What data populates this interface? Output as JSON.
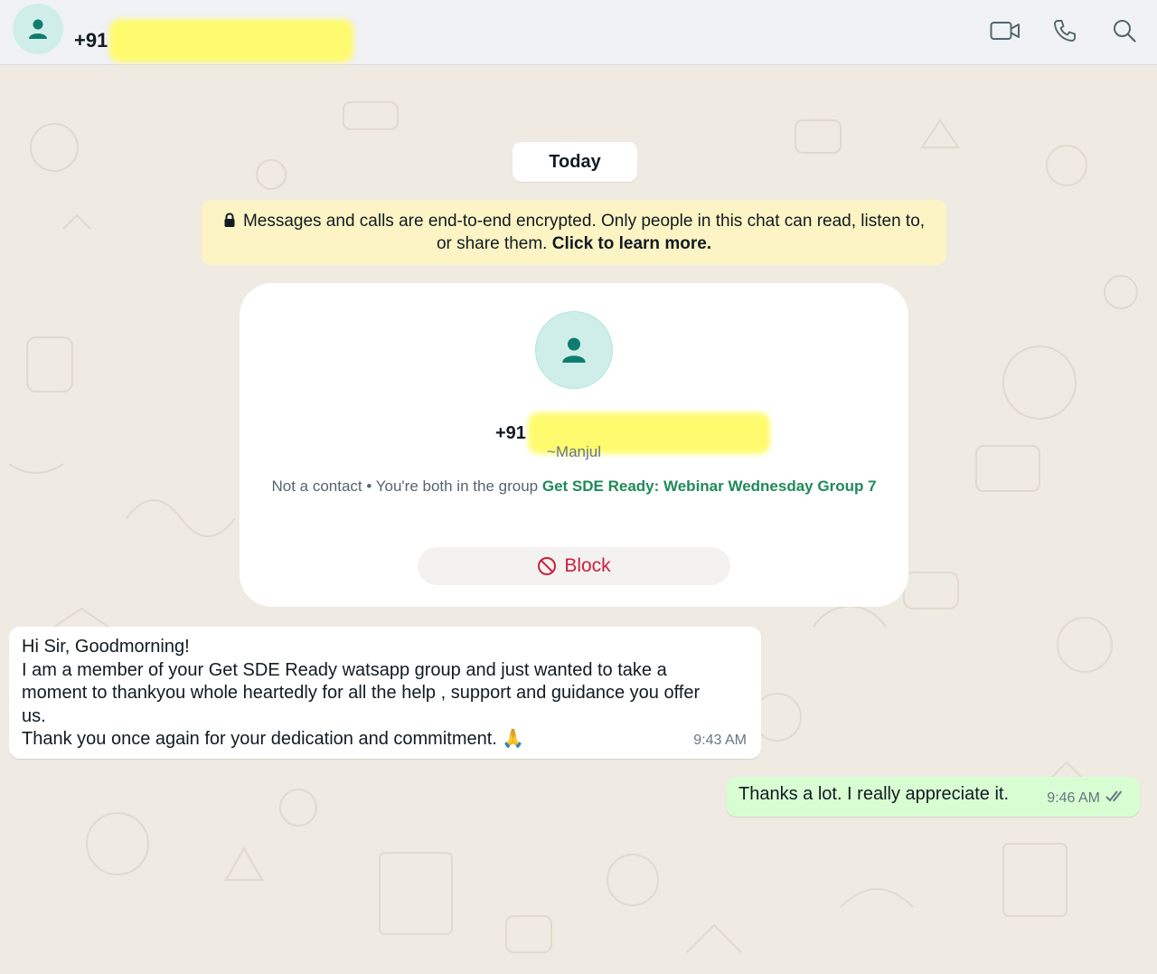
{
  "header": {
    "contact_prefix": "+91",
    "icons": [
      "person-avatar-icon",
      "video-call-icon",
      "voice-call-icon",
      "search-icon"
    ]
  },
  "chat": {
    "date_chip": "Today",
    "encryption_notice": {
      "text": "Messages and calls are end-to-end encrypted. Only people in this chat can read, listen to, or share them.",
      "link": "Click to learn more."
    },
    "contact_card": {
      "phone_prefix": "+91",
      "alias": "~Manjul",
      "info_prefix": "Not a contact • You're both in the group",
      "group_name": "Get SDE Ready: Webinar Wednesday Group 7",
      "block_label": "Block"
    },
    "messages": [
      {
        "direction": "incoming",
        "lines": [
          "Hi Sir, Goodmorning!",
          "I am a member of your Get SDE Ready watsapp group and just wanted to take a",
          "moment to thankyou whole heartedly for all the help , support and guidance you offer",
          "us.",
          "Thank you once again for your dedication and commitment. 🙏"
        ],
        "time": "9:43 AM"
      },
      {
        "direction": "outgoing",
        "text": "Thanks a lot. I really appreciate it.",
        "time": "9:46 AM",
        "status": "read"
      }
    ]
  },
  "colors": {
    "header_bg": "#f0f2f5",
    "chat_bg": "#efeae2",
    "notice_bg": "#fdf4c5",
    "outgoing_bg": "#d9fdd3",
    "accent_green": "#1f8a5a",
    "block_red": "#cc1f3d",
    "avatar_bg": "#cfeeea",
    "avatar_fg": "#0f7d6e"
  }
}
